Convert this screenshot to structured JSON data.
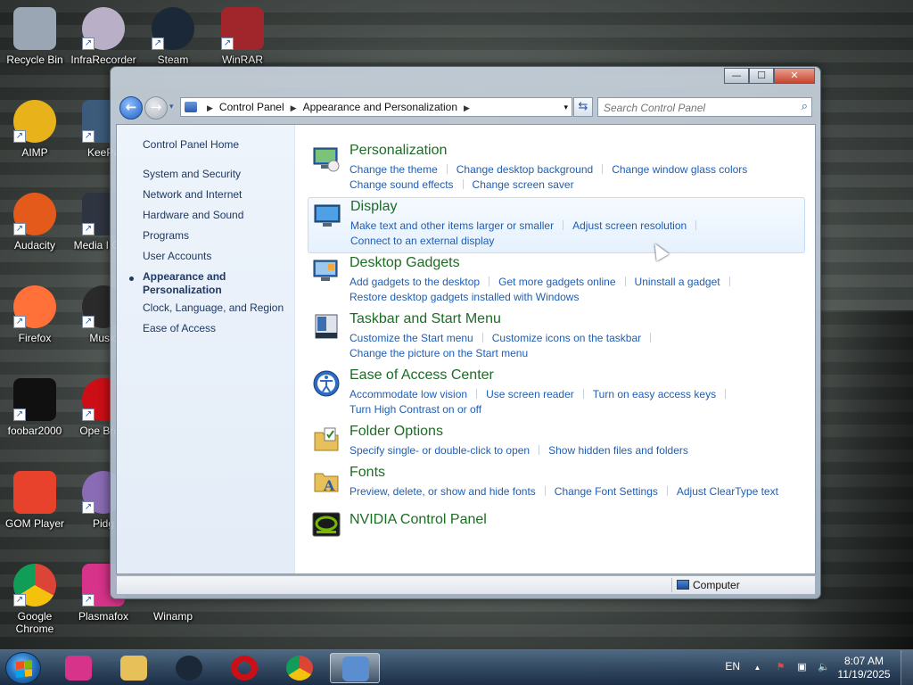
{
  "desktop": {
    "icons": [
      {
        "label": "Recycle Bin",
        "color": "#9aa6b3"
      },
      {
        "label": "InfraRecorder",
        "color": "#b9b0c8"
      },
      {
        "label": "Steam",
        "color": "#1b2838"
      },
      {
        "label": "WinRAR",
        "color": "#a0262b"
      },
      {
        "label": "AIMP",
        "color": "#e8b31a"
      },
      {
        "label": "KeePa",
        "color": "#3c5b7a"
      },
      {
        "label": "Audacity",
        "color": "#e35a1a"
      },
      {
        "label": "Media I Clas",
        "color": "#2f3540"
      },
      {
        "label": "Firefox",
        "color": "#ff7139"
      },
      {
        "label": "Music",
        "color": "#2a2a2a"
      },
      {
        "label": "foobar2000",
        "color": "#101010"
      },
      {
        "label": "Ope Brow",
        "color": "#cc0f16"
      },
      {
        "label": "GOM Player",
        "color": "#e8412c"
      },
      {
        "label": "Pidg",
        "color": "#8a6bb5"
      },
      {
        "label": "Google Chrome",
        "color": "#e9c63a"
      },
      {
        "label": "Plasmafox",
        "color": "#d8338a"
      },
      {
        "label": "Winamp",
        "color": "#505050"
      }
    ]
  },
  "window": {
    "caption": {
      "minimize": "—",
      "maximize": "☐",
      "close": "✕"
    },
    "nav": {
      "back_glyph": "←",
      "forward_glyph": "→",
      "dropdown_glyph": "▾"
    },
    "address": {
      "crumb1": "Control Panel",
      "crumb2": "Appearance and Personalization",
      "sep": "▶",
      "drop": "▾"
    },
    "refresh_glyph": "⇆",
    "search": {
      "placeholder": "Search Control Panel",
      "glyph": "⌕"
    },
    "sidebar": {
      "home": "Control Panel Home",
      "items": [
        "System and Security",
        "Network and Internet",
        "Hardware and Sound",
        "Programs",
        "User Accounts",
        "Appearance and Personalization",
        "Clock, Language, and Region",
        "Ease of Access"
      ]
    },
    "categories": [
      {
        "title": "Personalization",
        "icon": "personalization-icon",
        "rows": [
          [
            "Change the theme",
            "Change desktop background",
            "Change window glass colors"
          ],
          [
            "Change sound effects",
            "Change screen saver"
          ]
        ]
      },
      {
        "title": "Display",
        "icon": "display-icon",
        "rows": [
          [
            "Make text and other items larger or smaller",
            "Adjust screen resolution"
          ],
          [
            "Connect to an external display"
          ]
        ]
      },
      {
        "title": "Desktop Gadgets",
        "icon": "gadgets-icon",
        "rows": [
          [
            "Add gadgets to the desktop",
            "Get more gadgets online",
            "Uninstall a gadget"
          ],
          [
            "Restore desktop gadgets installed with Windows"
          ]
        ]
      },
      {
        "title": "Taskbar and Start Menu",
        "icon": "taskbar-icon",
        "rows": [
          [
            "Customize the Start menu",
            "Customize icons on the taskbar"
          ],
          [
            "Change the picture on the Start menu"
          ]
        ]
      },
      {
        "title": "Ease of Access Center",
        "icon": "ease-of-access-icon",
        "rows": [
          [
            "Accommodate low vision",
            "Use screen reader",
            "Turn on easy access keys"
          ],
          [
            "Turn High Contrast on or off"
          ]
        ]
      },
      {
        "title": "Folder Options",
        "icon": "folder-options-icon",
        "rows": [
          [
            "Specify single- or double-click to open",
            "Show hidden files and folders"
          ]
        ]
      },
      {
        "title": "Fonts",
        "icon": "fonts-icon",
        "rows": [
          [
            "Preview, delete, or show and hide fonts",
            "Change Font Settings",
            "Adjust ClearType text"
          ]
        ]
      },
      {
        "title": "NVIDIA Control Panel",
        "icon": "nvidia-icon",
        "rows": []
      }
    ],
    "status": {
      "computer": "Computer"
    }
  },
  "taskbar": {
    "apps": [
      {
        "name": "Plasmafox",
        "color": "#d8338a"
      },
      {
        "name": "Windows Explorer",
        "color": "#e8c05a"
      },
      {
        "name": "Steam",
        "color": "#1b2838"
      },
      {
        "name": "Opera",
        "color": "#cc0f16"
      },
      {
        "name": "Google Chrome",
        "color": "#e9c63a"
      },
      {
        "name": "Control Panel",
        "color": "#5a8ed0"
      }
    ],
    "lang": "EN",
    "tray_up": "▲",
    "tray_flag": "⚑",
    "tray_network": "▣",
    "tray_volume": "🔈",
    "time": "8:07 AM",
    "date": "11/19/2025"
  }
}
